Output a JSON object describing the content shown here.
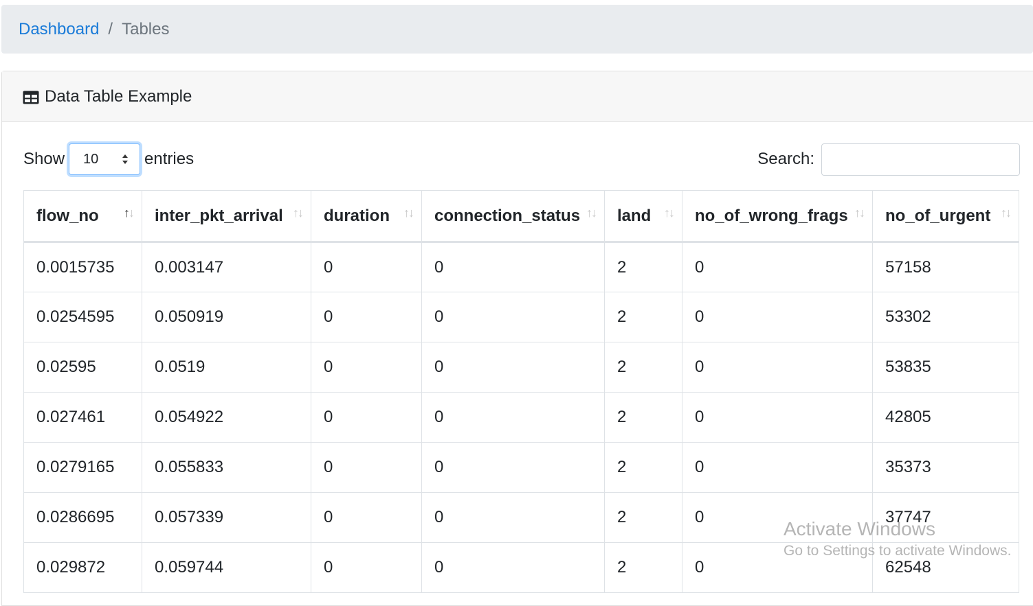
{
  "breadcrumb": {
    "link": "Dashboard",
    "separator": "/",
    "active": "Tables"
  },
  "card": {
    "title": "Data Table Example",
    "icon": "table-icon"
  },
  "controls": {
    "show_label": "Show",
    "entries_value": "10",
    "entries_label": "entries",
    "search_label": "Search:",
    "search_value": ""
  },
  "table": {
    "columns": [
      "flow_no",
      "inter_pkt_arrival",
      "duration",
      "connection_status",
      "land",
      "no_of_wrong_frags",
      "no_of_urgent"
    ],
    "sorted_column": "flow_no",
    "rows": [
      [
        "0.0015735",
        "0.003147",
        "0",
        "0",
        "2",
        "0",
        "57158"
      ],
      [
        "0.0254595",
        "0.050919",
        "0",
        "0",
        "2",
        "0",
        "53302"
      ],
      [
        "0.02595",
        "0.0519",
        "0",
        "0",
        "2",
        "0",
        "53835"
      ],
      [
        "0.027461",
        "0.054922",
        "0",
        "0",
        "2",
        "0",
        "42805"
      ],
      [
        "0.0279165",
        "0.055833",
        "0",
        "0",
        "2",
        "0",
        "35373"
      ],
      [
        "0.0286695",
        "0.057339",
        "0",
        "0",
        "2",
        "0",
        "37747"
      ],
      [
        "0.029872",
        "0.059744",
        "0",
        "0",
        "2",
        "0",
        "62548"
      ]
    ]
  },
  "watermark": {
    "title": "Activate Windows",
    "subtitle": "Go to Settings to activate Windows."
  },
  "colors": {
    "link": "#1a7bd8",
    "breadcrumb_bg": "#e9ecef",
    "card_header_bg": "#f7f7f7"
  }
}
